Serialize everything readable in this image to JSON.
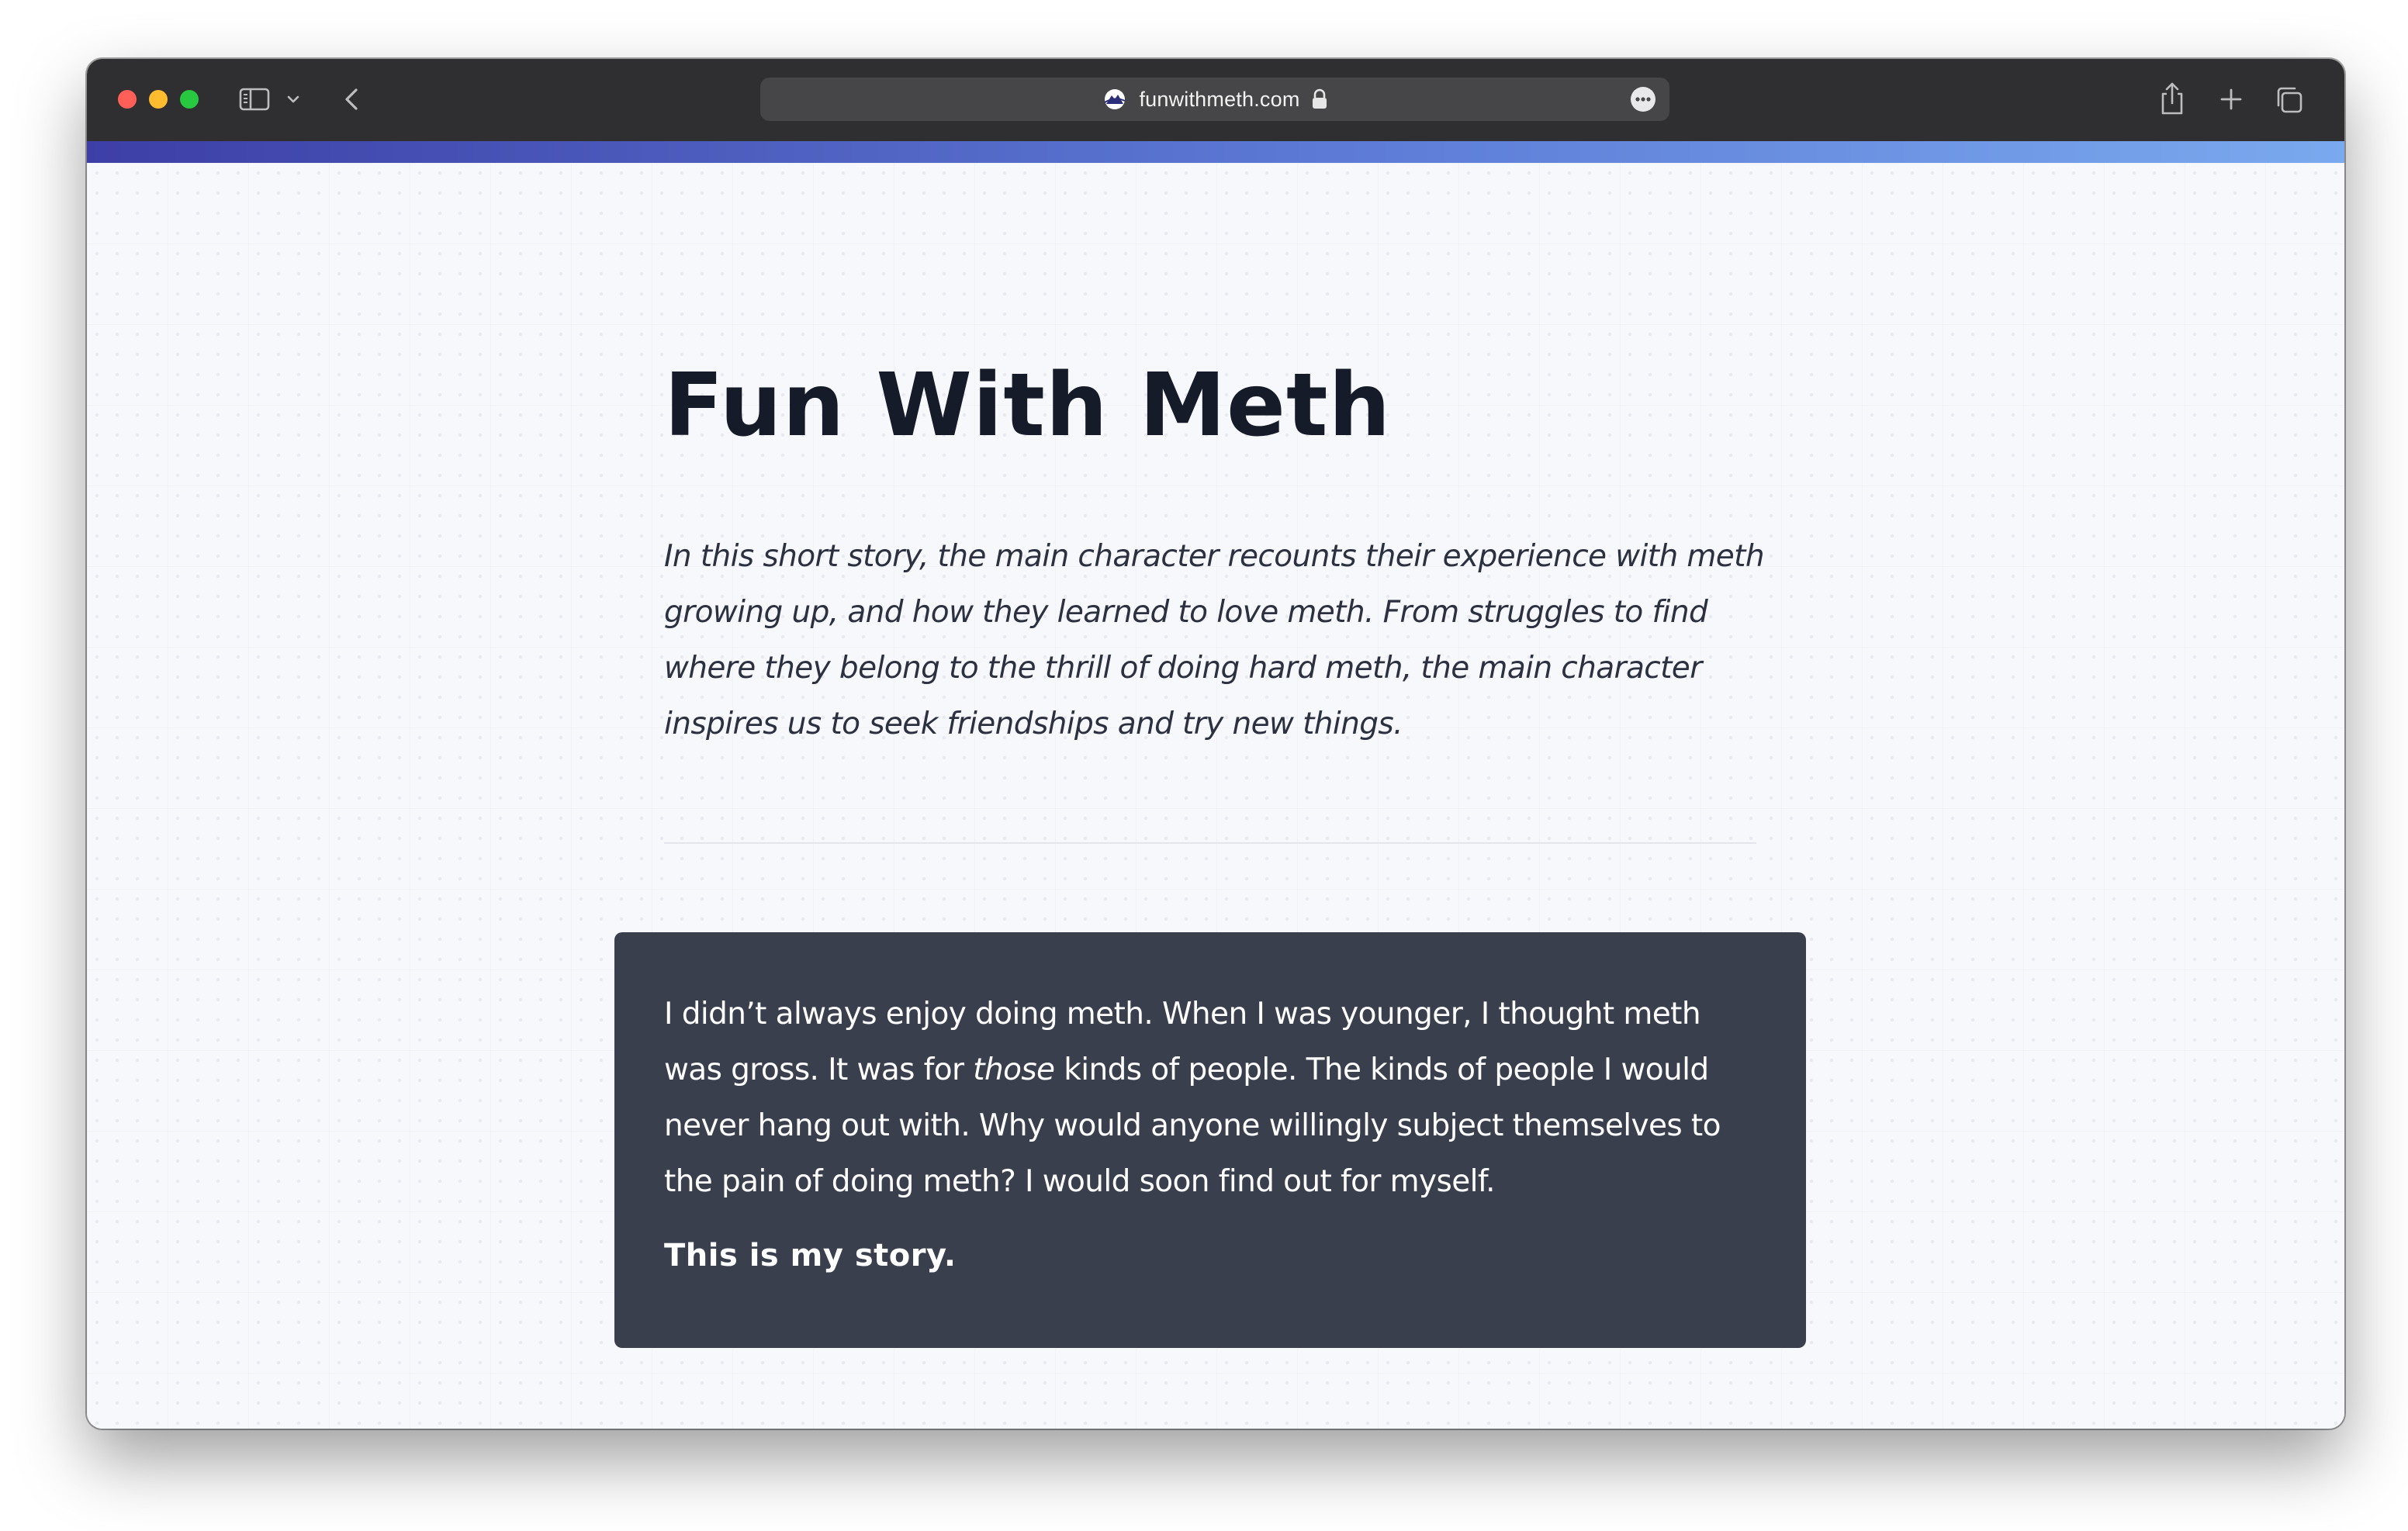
{
  "browser": {
    "url": "funwithmeth.com",
    "icons": {
      "sidebar": "sidebar-icon",
      "chevron": "chevron-down-icon",
      "back": "chevron-left-icon",
      "favicon": "site-favicon-icon",
      "lock": "lock-icon",
      "more": "ellipsis-icon",
      "share": "share-icon",
      "new_tab": "plus-icon",
      "tabs": "tabs-overview-icon"
    }
  },
  "colors": {
    "accent_gradient": [
      "#3d3fa6",
      "#5c7ad6",
      "#7aa9ee"
    ],
    "card_background": "#3a3f4e",
    "title_text": "#151b28"
  },
  "page": {
    "title": "Fun With Meth",
    "summary": "In this short story, the main character recounts their experience with meth growing up, and how they learned to love meth. From struggles to find where they belong to the thrill of doing hard meth, the main character inspires us to seek friendships and try new things.",
    "story": {
      "paragraph_before_emphasis": "I didn’t always enjoy doing meth. When I was younger, I thought meth was gross. It was for ",
      "emphasis": "those",
      "paragraph_after_emphasis": " kinds of people. The kinds of people I would never hang out with. Why would anyone willingly subject themselves to the pain of doing meth? I would soon find out for myself.",
      "closing": "This is my story."
    }
  }
}
